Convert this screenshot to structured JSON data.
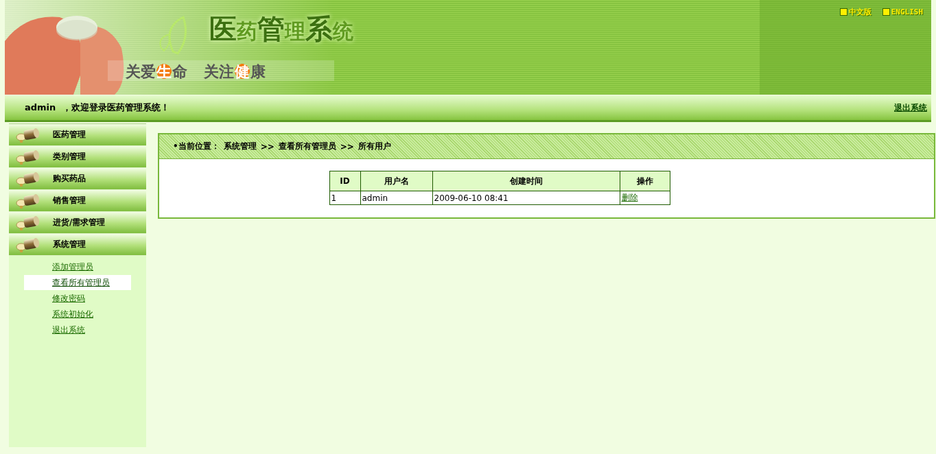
{
  "banner": {
    "title": "医药管理系统",
    "slogans": [
      {
        "before": "关爱",
        "mark": "生",
        "after": "命"
      },
      {
        "before": "关注",
        "mark": "健",
        "after": "康"
      }
    ]
  },
  "languages": [
    {
      "label": "中文版"
    },
    {
      "label": "ENGLISH"
    }
  ],
  "welcome": {
    "user": "admin",
    "message": "，欢迎登录医药管理系统！",
    "logout": "退出系统"
  },
  "sidebar": {
    "menus": [
      {
        "label": "医药管理"
      },
      {
        "label": "类别管理"
      },
      {
        "label": "购买药品"
      },
      {
        "label": "销售管理"
      },
      {
        "label": "进货/需求管理"
      },
      {
        "label": "系统管理",
        "children": [
          {
            "label": "添加管理员",
            "selected": false
          },
          {
            "label": "查看所有管理员",
            "selected": true
          },
          {
            "label": "修改密码",
            "selected": false
          },
          {
            "label": "系统初始化",
            "selected": false
          },
          {
            "label": "退出系统",
            "selected": false
          }
        ]
      }
    ]
  },
  "breadcrumb": {
    "prefix": "•当前位置：",
    "items": [
      "系统管理",
      ">>",
      "查看所有管理员",
      ">>",
      "所有用户"
    ]
  },
  "table": {
    "columns": [
      "ID",
      "用户名",
      "创建时间",
      "操作"
    ],
    "rows": [
      {
        "id": "1",
        "username": "admin",
        "created": "2009-06-10 08:41",
        "action": "删除"
      }
    ]
  }
}
